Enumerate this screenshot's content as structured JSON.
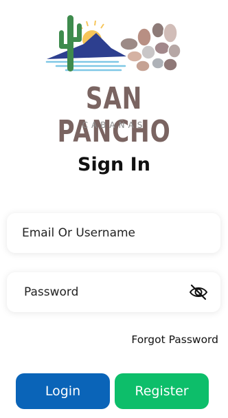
{
  "brand": {
    "name": "SAN PANCHO",
    "subtitle": "CABAÑAS"
  },
  "signin": {
    "title": "Sign In",
    "email_placeholder": "Email Or Username",
    "password_placeholder": "Password",
    "password_visibility_icon": "eye-slash-icon",
    "forgot_password": "Forgot Password"
  },
  "actions": {
    "login_label": "Login",
    "register_label": "Register"
  },
  "colors": {
    "login_button": "#0a64b8",
    "register_button": "#0dbe6a",
    "brand_text": "#7a6461"
  }
}
